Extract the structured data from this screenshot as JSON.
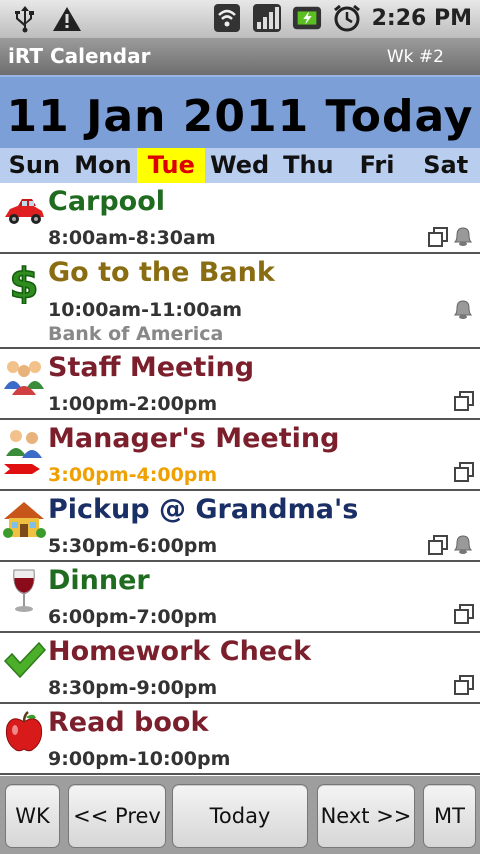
{
  "status_bar": {
    "time": "2:26 PM",
    "icons": [
      "usb-icon",
      "warning-icon",
      "wifi-icon",
      "signal-icon",
      "battery-icon",
      "alarm-clock-icon"
    ]
  },
  "app": {
    "title": "iRT Calendar",
    "week": "Wk #2"
  },
  "header": {
    "date": "11 Jan 2011 Today"
  },
  "weekdays": [
    "Sun",
    "Mon",
    "Tue",
    "Wed",
    "Thu",
    "Fri",
    "Sat"
  ],
  "selected_day": "Tue",
  "events": [
    {
      "title": "Carpool",
      "time": "8:00am-8:30am",
      "location": "",
      "icon": "car-icon",
      "title_color": "#1f6b1f",
      "time_color": "#333333",
      "repeat": true,
      "alarm": true
    },
    {
      "title": "Go to the Bank",
      "time": "10:00am-11:00am",
      "location": "Bank of America",
      "icon": "dollar-icon",
      "title_color": "#8a6d12",
      "time_color": "#333333",
      "repeat": false,
      "alarm": true
    },
    {
      "title": "Staff Meeting",
      "time": "1:00pm-2:00pm",
      "location": "",
      "icon": "group-icon",
      "title_color": "#7a1f2b",
      "time_color": "#333333",
      "repeat": true,
      "alarm": false
    },
    {
      "title": "Manager's Meeting",
      "time": "3:00pm-4:00pm",
      "location": "",
      "icon": "people-icon",
      "title_color": "#7a1f2b",
      "time_color": "#f0a000",
      "repeat": true,
      "alarm": false,
      "current": true
    },
    {
      "title": "Pickup @ Grandma's",
      "time": "5:30pm-6:00pm",
      "location": "",
      "icon": "house-icon",
      "title_color": "#1a2f66",
      "time_color": "#333333",
      "repeat": true,
      "alarm": true
    },
    {
      "title": "Dinner",
      "time": "6:00pm-7:00pm",
      "location": "",
      "icon": "wine-glass-icon",
      "title_color": "#1f6b1f",
      "time_color": "#333333",
      "repeat": true,
      "alarm": false
    },
    {
      "title": "Homework Check",
      "time": "8:30pm-9:00pm",
      "location": "",
      "icon": "checkmark-icon",
      "title_color": "#7a1f2b",
      "time_color": "#333333",
      "repeat": true,
      "alarm": false
    },
    {
      "title": "Read book",
      "time": "9:00pm-10:00pm",
      "location": "",
      "icon": "apple-icon",
      "title_color": "#7a1f2b",
      "time_color": "#333333",
      "repeat": false,
      "alarm": false
    }
  ],
  "buttons": {
    "wk": "WK",
    "prev": "<< Prev",
    "today": "Today",
    "next": "Next >>",
    "mt": "MT"
  }
}
